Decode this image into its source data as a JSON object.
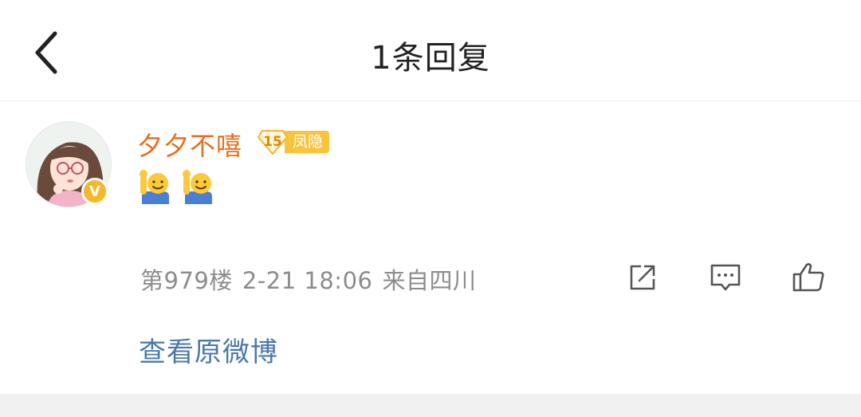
{
  "header": {
    "title": "1条回复",
    "back_icon": "chevron-left-icon"
  },
  "comment": {
    "username": "夕夕不嘻",
    "level": "15",
    "badge_label": "凤隐",
    "verified_mark": "V",
    "content_emojis": [
      "raising-hand-emoji",
      "raising-hand-emoji"
    ],
    "floor": "第979楼",
    "datetime": "2-21 18:06",
    "location": "来自四川",
    "actions": [
      "share-icon",
      "comment-icon",
      "like-icon"
    ]
  },
  "footer": {
    "view_original": "查看原微博"
  },
  "colors": {
    "username": "#e86e1c",
    "link": "#4a78a8",
    "meta": "#8c8c8c",
    "badge": "#f9c33c"
  }
}
